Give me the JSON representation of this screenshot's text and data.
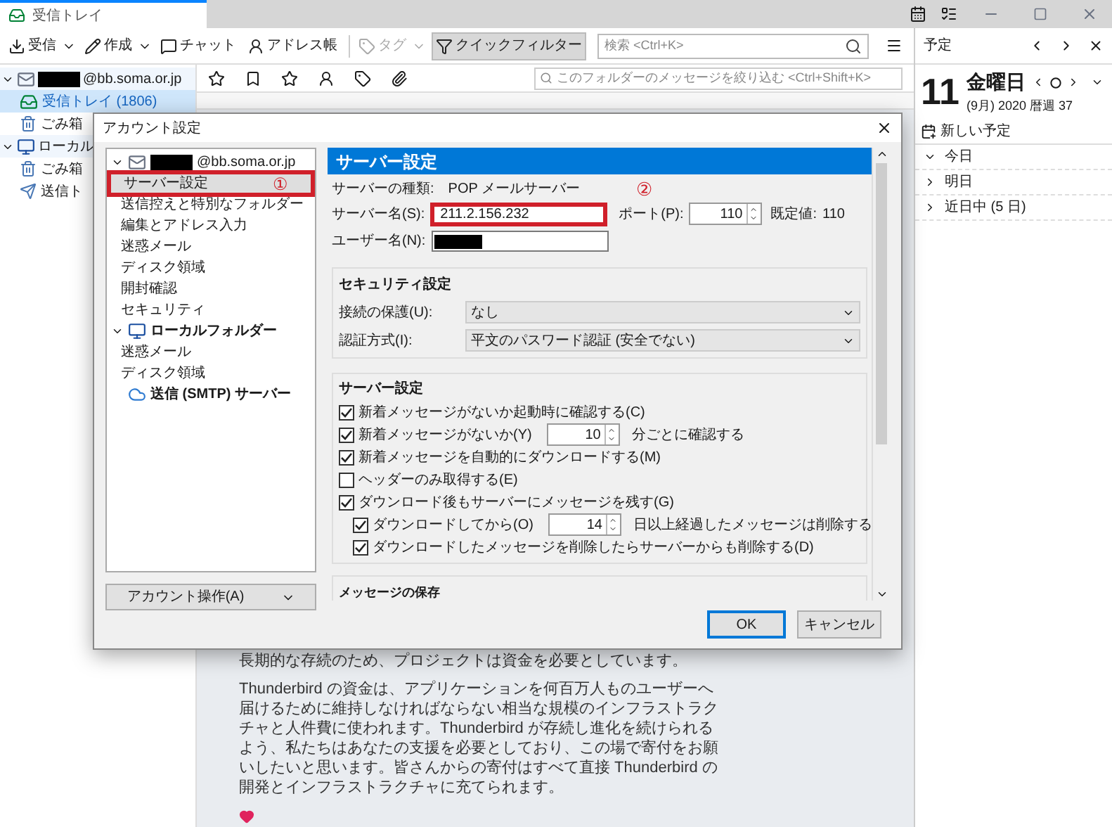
{
  "tab": {
    "label": "受信トレイ",
    "selected": true
  },
  "toolbar": [
    {
      "label": "受信",
      "kind": "dropdown",
      "disabled": false
    },
    {
      "label": "作成",
      "kind": "dropdown",
      "disabled": false
    },
    {
      "label": "チャット",
      "kind": "button",
      "disabled": false
    },
    {
      "label": "アドレス帳",
      "kind": "button",
      "disabled": false
    },
    {
      "label": "タグ",
      "kind": "dropdown",
      "disabled": true
    },
    {
      "label": "クイックフィルター",
      "kind": "toggle",
      "disabled": false
    }
  ],
  "search": {
    "placeholder": "検索 <Ctrl+K>"
  },
  "filter": {
    "placeholder": "このフォルダーのメッセージを絞り込む <Ctrl+Shift+K>"
  },
  "folders": [
    {
      "label": "@bb.soma.or.jp",
      "kind": "account",
      "expanded": true,
      "selected": false,
      "children": [
        {
          "label": "受信トレイ",
          "count": "(1806)",
          "kind": "inbox",
          "selected": true
        },
        {
          "label": "ごみ箱",
          "kind": "trash",
          "selected": false
        }
      ]
    },
    {
      "label": "ローカル",
      "kind": "local",
      "expanded": true,
      "selected": false,
      "children": [
        {
          "label": "ごみ箱",
          "kind": "trash",
          "selected": false
        },
        {
          "label": "送信ト",
          "kind": "outbox",
          "selected": false
        }
      ]
    }
  ],
  "message_body": {
    "paragraphs": [
      "長期的な存続のため、プロジェクトは資金を必要としています。",
      "Thunderbird の資金は、アプリケーションを何百万人ものユーザーへ届けるために維持しなければならない相当な規模のインフラストラクチャと人件費に使われます。Thunderbird が存続し進化を続けられるよう、私たちはあなたの支援を必要としており、この場で寄付をお願いしたいと思います。皆さんからの寄付はすべて直接 Thunderbird の開発とインフラストラクチャに充てられます。"
    ]
  },
  "calendar": {
    "title": "予定",
    "day": "11",
    "weekday": "金曜日",
    "subtitle": "(9月) 2020 暦週 37",
    "new_event": "新しい予定",
    "sections": [
      {
        "label": "今日",
        "expanded": true
      },
      {
        "label": "明日",
        "expanded": false
      },
      {
        "label": "近日中 (5 日)",
        "expanded": false
      }
    ]
  },
  "dialog": {
    "title": "アカウント設定",
    "tree": [
      {
        "label": "@bb.soma.or.jp",
        "kind": "account",
        "expanded": true,
        "selected": false,
        "children": [
          {
            "label": "サーバー設定",
            "selected": true,
            "highlighted": true
          },
          {
            "label": "送信控えと特別なフォルダー",
            "selected": false,
            "highlighted": false
          },
          {
            "label": "編集とアドレス入力",
            "selected": false,
            "highlighted": false
          },
          {
            "label": "迷惑メール",
            "selected": false,
            "highlighted": false
          },
          {
            "label": "ディスク領域",
            "selected": false,
            "highlighted": false
          },
          {
            "label": "開封確認",
            "selected": false,
            "highlighted": false
          },
          {
            "label": "セキュリティ",
            "selected": false,
            "highlighted": false
          }
        ]
      },
      {
        "label": "ローカルフォルダー",
        "kind": "local",
        "expanded": true,
        "selected": false,
        "children": [
          {
            "label": "迷惑メール",
            "selected": false,
            "highlighted": false
          },
          {
            "label": "ディスク領域",
            "selected": false,
            "highlighted": false
          }
        ]
      },
      {
        "label": "送信 (SMTP) サーバー",
        "kind": "smtp",
        "selected": false
      }
    ],
    "account_actions": "アカウント操作(A)",
    "header": "サーバー設定",
    "server_type_label": "サーバーの種類:",
    "server_type": "POP メールサーバー",
    "server_name_label": "サーバー名(S):",
    "server_name": "211.2.156.232",
    "server_name_highlighted": true,
    "port_label": "ポート(P):",
    "port": "110",
    "default_label": "既定値:",
    "default_port": "110",
    "username_label": "ユーザー名(N):",
    "security": {
      "title": "セキュリティ設定",
      "fields": [
        {
          "label": "接続の保護(U):",
          "value": "なし"
        },
        {
          "label": "認証方式(I):",
          "value": "平文のパスワード認証 (安全でない)"
        }
      ]
    },
    "server": {
      "title": "サーバー設定",
      "options": [
        {
          "label": "新着メッセージがないか起動時に確認する(C)",
          "checked": true,
          "kind": "check"
        },
        {
          "label": "新着メッセージがないか(Y)",
          "checked": true,
          "kind": "spin",
          "value": "10",
          "suffix": "分ごとに確認する"
        },
        {
          "label": "新着メッセージを自動的にダウンロードする(M)",
          "checked": true,
          "kind": "check"
        },
        {
          "label": "ヘッダーのみ取得する(E)",
          "checked": false,
          "kind": "check"
        },
        {
          "label": "ダウンロード後もサーバーにメッセージを残す(G)",
          "checked": true,
          "kind": "check",
          "children": [
            {
              "label": "ダウンロードしてから(O)",
              "checked": true,
              "kind": "spin",
              "value": "14",
              "suffix": "日以上経過したメッセージは削除する"
            },
            {
              "label": "ダウンロードしたメッセージを削除したらサーバーからも削除する(D)",
              "checked": true,
              "kind": "check"
            }
          ]
        }
      ]
    },
    "storage": {
      "title": "メッセージの保存"
    },
    "buttons": [
      {
        "label": "OK",
        "default": true
      },
      {
        "label": "キャンセル",
        "default": false
      }
    ]
  },
  "annotations": [
    {
      "label": "①"
    },
    {
      "label": "②"
    }
  ]
}
